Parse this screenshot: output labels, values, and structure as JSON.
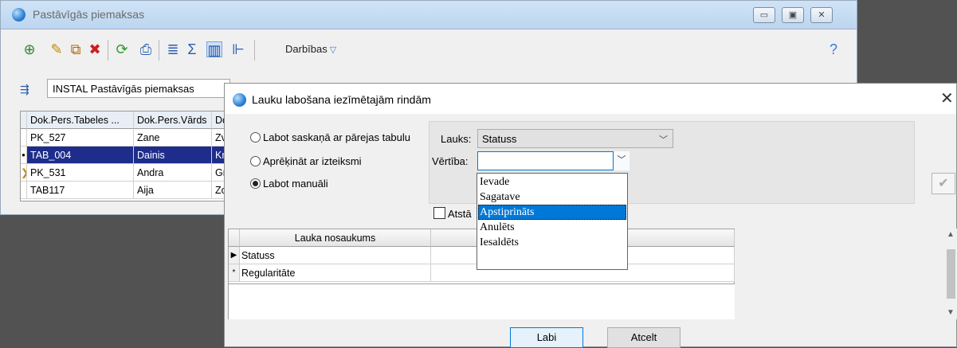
{
  "bg_window": {
    "title": "Pastāvīgās piemaksas",
    "toolbar_action": "Darbības",
    "selector_value": "INSTAL Pastāvīgās piemaksas",
    "grid": {
      "columns": [
        "Dok.Pers.Tabeles ...",
        "Dok.Pers.Vārds",
        "Dc"
      ],
      "rows": [
        {
          "marker": "",
          "tab": "PK_527",
          "name": "Zane",
          "col3": "Zv"
        },
        {
          "marker": "•",
          "tab": "TAB_004",
          "name": "Dainis",
          "col3": "Kr"
        },
        {
          "marker": "❯",
          "tab": "PK_531",
          "name": "Andra",
          "col3": "Gr"
        },
        {
          "marker": "",
          "tab": "TAB117",
          "name": "Aija",
          "col3": "Zc"
        }
      ]
    }
  },
  "dialog": {
    "title": "Lauku labošana iezīmētajām rindām",
    "close_glyph": "✕",
    "options": [
      {
        "label": "Labot saskaņā ar pārejas tabulu",
        "selected": false
      },
      {
        "label": "Aprēķināt ar izteiksmi",
        "selected": false
      },
      {
        "label": "Labot manuāli",
        "selected": true
      }
    ],
    "field_label": "Lauks:",
    "field_value": "Statuss",
    "value_label": "Vērtība:",
    "value_value": "",
    "dropdown_items": [
      "Ievade",
      "Sagatave",
      "Apstiprināts",
      "Anulēts",
      "Iesaldēts"
    ],
    "dropdown_highlighted_index": 2,
    "checkbox_label": "Atstā",
    "table": {
      "header": "Lauka nosaukums",
      "rows": [
        {
          "marker": "▶",
          "name": "Statuss"
        },
        {
          "marker": "*",
          "name": "Regularitāte"
        }
      ]
    },
    "ok_label": "Labi",
    "cancel_label": "Atcelt"
  },
  "colors": {
    "selection": "#1e2d8b",
    "highlight": "#0078d7",
    "background": "#525252"
  }
}
